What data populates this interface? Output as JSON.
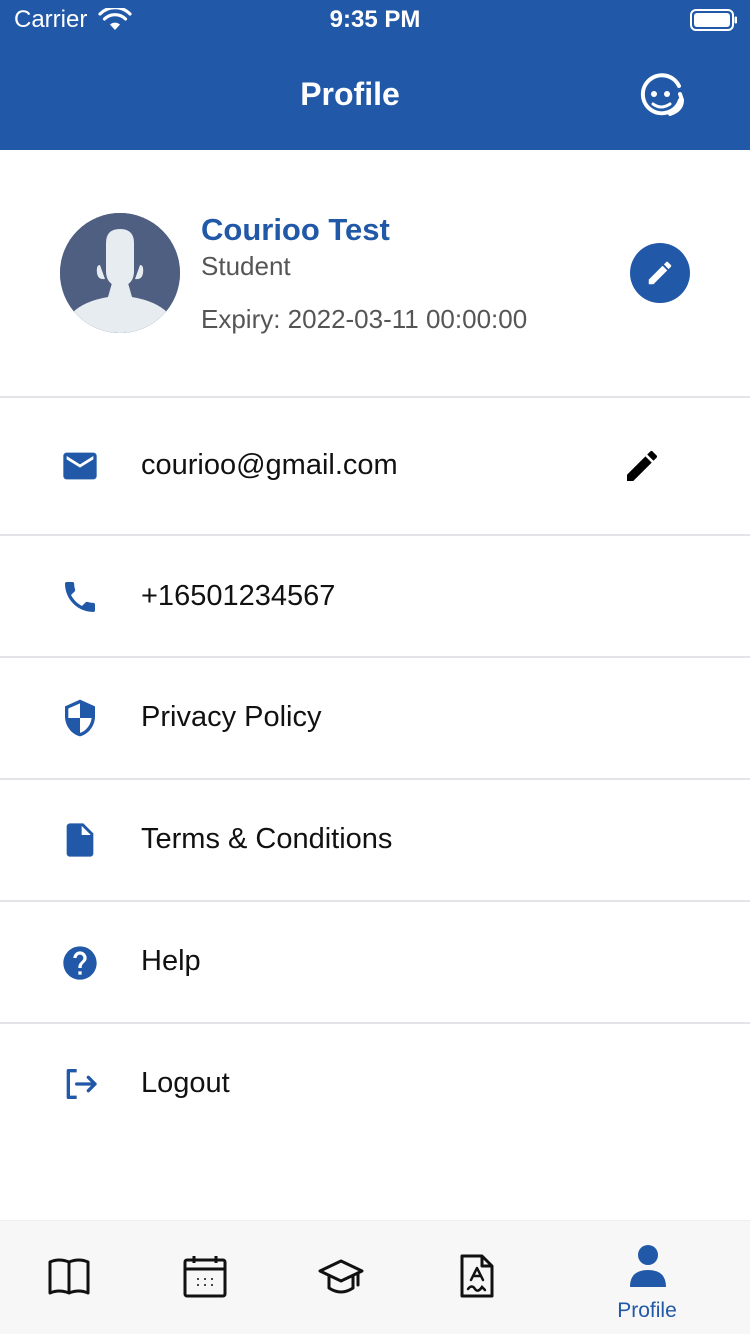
{
  "status_bar": {
    "carrier": "Carrier",
    "time": "9:35 PM"
  },
  "header": {
    "title": "Profile",
    "support_icon": "support-agent-icon"
  },
  "profile": {
    "name": "Courioo Test",
    "role": "Student",
    "expiry": "Expiry: 2022-03-11 00:00:00"
  },
  "rows": [
    {
      "icon": "email-icon",
      "label": "courioo@gmail.com",
      "editable": true
    },
    {
      "icon": "phone-icon",
      "label": "+16501234567"
    },
    {
      "icon": "shield-icon",
      "label": "Privacy Policy"
    },
    {
      "icon": "document-icon",
      "label": "Terms & Conditions"
    },
    {
      "icon": "help-icon",
      "label": "Help"
    },
    {
      "icon": "logout-icon",
      "label": "Logout"
    }
  ],
  "tabbar": {
    "tabs": [
      {
        "icon": "book-icon",
        "label": ""
      },
      {
        "icon": "calendar-icon",
        "label": ""
      },
      {
        "icon": "graduation-cap-icon",
        "label": ""
      },
      {
        "icon": "document-grade-icon",
        "label": ""
      },
      {
        "icon": "person-icon",
        "label": "Profile",
        "active": true
      }
    ]
  },
  "colors": {
    "primary": "#2158a7",
    "text": "#111111",
    "muted": "#555555"
  }
}
